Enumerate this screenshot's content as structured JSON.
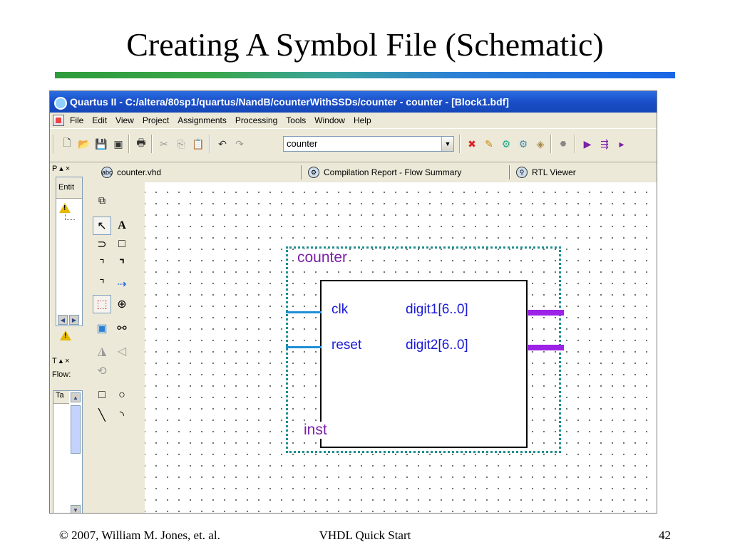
{
  "slide": {
    "title": "Creating A Symbol File (Schematic)",
    "footer_left": "© 2007, William M. Jones, et. al.",
    "footer_center": "VHDL Quick Start",
    "footer_right": "42"
  },
  "window": {
    "title": "Quartus II - C:/altera/80sp1/quartus/NandB/counterWithSSDs/counter - counter - [Block1.bdf]"
  },
  "menu": [
    "File",
    "Edit",
    "View",
    "Project",
    "Assignments",
    "Processing",
    "Tools",
    "Window",
    "Help"
  ],
  "toolbar": {
    "entity_value": "counter"
  },
  "panes": {
    "project_header": "P ▴ ×",
    "entity_column": "Entit",
    "tasks_header": "T ▴ ×",
    "flow_label": "Flow:",
    "task_column": "Ta"
  },
  "tabs": [
    {
      "label": "counter.vhd",
      "icon": "vhdl-file-icon"
    },
    {
      "label": "Compilation Report - Flow Summary",
      "icon": "compile-report-icon"
    },
    {
      "label": "RTL Viewer",
      "icon": "rtl-viewer-icon"
    }
  ],
  "symbol": {
    "name": "counter",
    "instance": "inst",
    "inputs": [
      "clk",
      "reset"
    ],
    "outputs": [
      "digit1[6..0]",
      "digit2[6..0]"
    ],
    "colors": {
      "frame": "#1f8f8f",
      "name_text": "#7a1fa8",
      "port_text": "#1a1ad6",
      "input_pin": "#1e8fd6",
      "output_bus": "#9b22e6"
    }
  }
}
